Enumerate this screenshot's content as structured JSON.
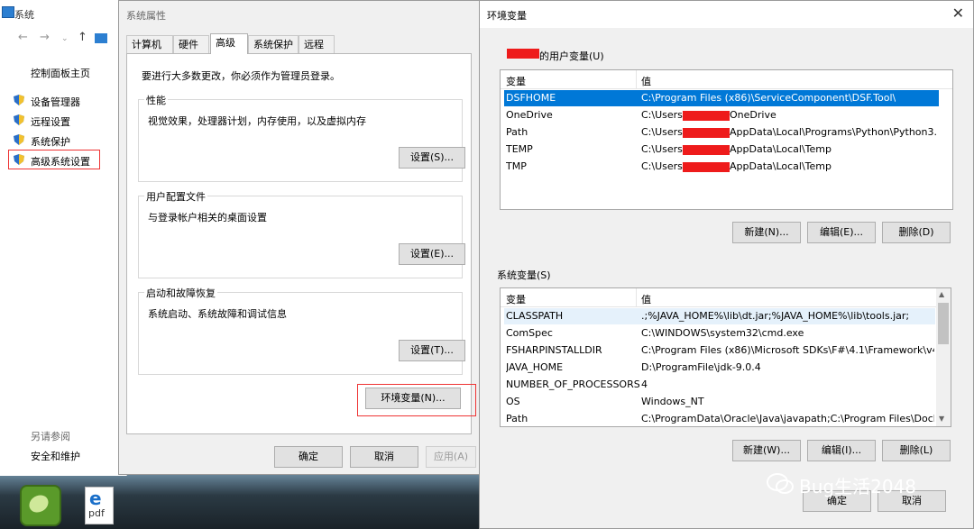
{
  "system_window": {
    "title": "系统",
    "home_link": "控制面板主页",
    "links": [
      "设备管理器",
      "远程设置",
      "系统保护",
      "高级系统设置"
    ],
    "see_also": "另请参阅",
    "security": "安全和维护"
  },
  "props_dialog": {
    "title": "系统属性",
    "tabs": [
      "计算机名",
      "硬件",
      "高级",
      "系统保护",
      "远程"
    ],
    "active_tab": "高级",
    "admin_note": "要进行大多数更改，你必须作为管理员登录。",
    "performance": {
      "title": "性能",
      "desc": "视觉效果，处理器计划，内存使用，以及虚拟内存",
      "button": "设置(S)..."
    },
    "profile": {
      "title": "用户配置文件",
      "desc": "与登录帐户相关的桌面设置",
      "button": "设置(E)..."
    },
    "startup": {
      "title": "启动和故障恢复",
      "desc": "系统启动、系统故障和调试信息",
      "button": "设置(T)..."
    },
    "env_button": "环境变量(N)...",
    "ok": "确定",
    "cancel": "取消",
    "apply": "应用(A)"
  },
  "env_dialog": {
    "title": "环境变量",
    "close": "✕",
    "user_section_suffix": "的用户变量(U)",
    "col_var": "变量",
    "col_val": "值",
    "user_vars": [
      {
        "name": "DSFHOME",
        "value": "C:\\Program Files (x86)\\ServiceComponent\\DSF.Tool\\"
      },
      {
        "name": "OneDrive",
        "value_prefix": "C:\\Users\\",
        "value_suffix": "OneDrive"
      },
      {
        "name": "Path",
        "value_prefix": "C:\\Users\\",
        "value_suffix": "AppData\\Local\\Programs\\Python\\Python3..."
      },
      {
        "name": "TEMP",
        "value_prefix": "C:\\Users\\",
        "value_suffix": "AppData\\Local\\Temp"
      },
      {
        "name": "TMP",
        "value_prefix": "C:\\Users\\",
        "value_suffix": "AppData\\Local\\Temp"
      }
    ],
    "user_buttons": {
      "new": "新建(N)...",
      "edit": "编辑(E)...",
      "delete": "删除(D)"
    },
    "system_section": "系统变量(S)",
    "system_vars": [
      {
        "name": "CLASSPATH",
        "value": ".;%JAVA_HOME%\\lib\\dt.jar;%JAVA_HOME%\\lib\\tools.jar;"
      },
      {
        "name": "ComSpec",
        "value": "C:\\WINDOWS\\system32\\cmd.exe"
      },
      {
        "name": "FSHARPINSTALLDIR",
        "value": "C:\\Program Files (x86)\\Microsoft SDKs\\F#\\4.1\\Framework\\v4...."
      },
      {
        "name": "JAVA_HOME",
        "value": "D:\\ProgramFile\\jdk-9.0.4"
      },
      {
        "name": "NUMBER_OF_PROCESSORS",
        "value": "4"
      },
      {
        "name": "OS",
        "value": "Windows_NT"
      },
      {
        "name": "Path",
        "value": "C:\\ProgramData\\Oracle\\Java\\javapath;C:\\Program Files\\Dock..."
      }
    ],
    "system_buttons": {
      "new": "新建(W)...",
      "edit": "编辑(I)...",
      "delete": "删除(L)"
    },
    "ok": "确定",
    "cancel": "取消"
  },
  "desktop": {
    "pdf_label": "pdf",
    "watermark": "Bug生活2048"
  },
  "colors": {
    "selected": "#0078d7",
    "highlight": "#e33333",
    "redact": "#ee1b1b"
  }
}
